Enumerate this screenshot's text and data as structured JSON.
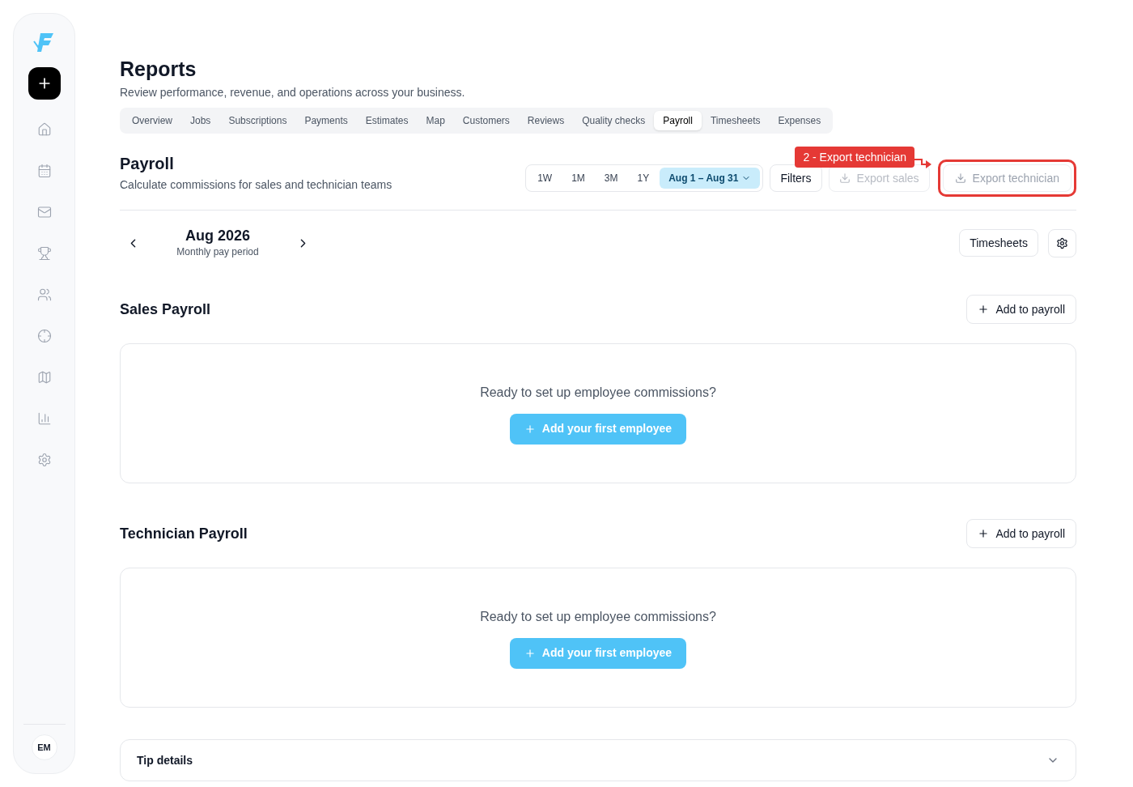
{
  "sidebar": {
    "avatar": "EM",
    "items": [
      {
        "kind": "home",
        "selected": false
      },
      {
        "kind": "calendar",
        "selected": false
      },
      {
        "kind": "mail",
        "selected": false
      },
      {
        "kind": "trophy",
        "selected": false
      },
      {
        "kind": "users",
        "selected": false
      },
      {
        "kind": "target",
        "selected": false
      },
      {
        "kind": "map",
        "selected": false
      },
      {
        "kind": "chart",
        "selected": false
      },
      {
        "kind": "settings",
        "selected": false
      }
    ]
  },
  "page": {
    "title": "Reports",
    "subtitle": "Review performance, revenue, and operations across your business."
  },
  "tabs": [
    {
      "label": "Overview",
      "selected": false
    },
    {
      "label": "Jobs",
      "selected": false
    },
    {
      "label": "Subscriptions",
      "selected": false
    },
    {
      "label": "Payments",
      "selected": false
    },
    {
      "label": "Estimates",
      "selected": false
    },
    {
      "label": "Map",
      "selected": false
    },
    {
      "label": "Customers",
      "selected": false
    },
    {
      "label": "Reviews",
      "selected": false
    },
    {
      "label": "Quality checks",
      "selected": false
    },
    {
      "label": "Payroll",
      "selected": true
    },
    {
      "label": "Timesheets",
      "selected": false
    },
    {
      "label": "Expenses",
      "selected": false
    }
  ],
  "section": {
    "title": "Payroll",
    "subtitle": "Calculate commissions for sales and technician teams"
  },
  "ranges": [
    {
      "label": "1W",
      "selected": false
    },
    {
      "label": "1M",
      "selected": false
    },
    {
      "label": "3M",
      "selected": false
    },
    {
      "label": "1Y",
      "selected": false
    },
    {
      "label": "Aug 1 – Aug 31",
      "selected": true
    }
  ],
  "filters": "Filters",
  "export_sales": "Export sales",
  "export_technician": "Export technician",
  "annotation": {
    "label": "2 - Export technician"
  },
  "period": {
    "month": "Aug 2026",
    "caption": "Monthly pay period"
  },
  "timesheets_button": "Timesheets",
  "payrolls": [
    {
      "title": "Sales Payroll",
      "add": "Add to payroll",
      "empty": "Ready to set up employee commissions?",
      "cta": "Add your first employee"
    },
    {
      "title": "Technician Payroll",
      "add": "Add to payroll",
      "empty": "Ready to set up employee commissions?",
      "cta": "Add your first employee"
    }
  ],
  "tip_details": {
    "label": "Tip details",
    "expanded": false
  }
}
